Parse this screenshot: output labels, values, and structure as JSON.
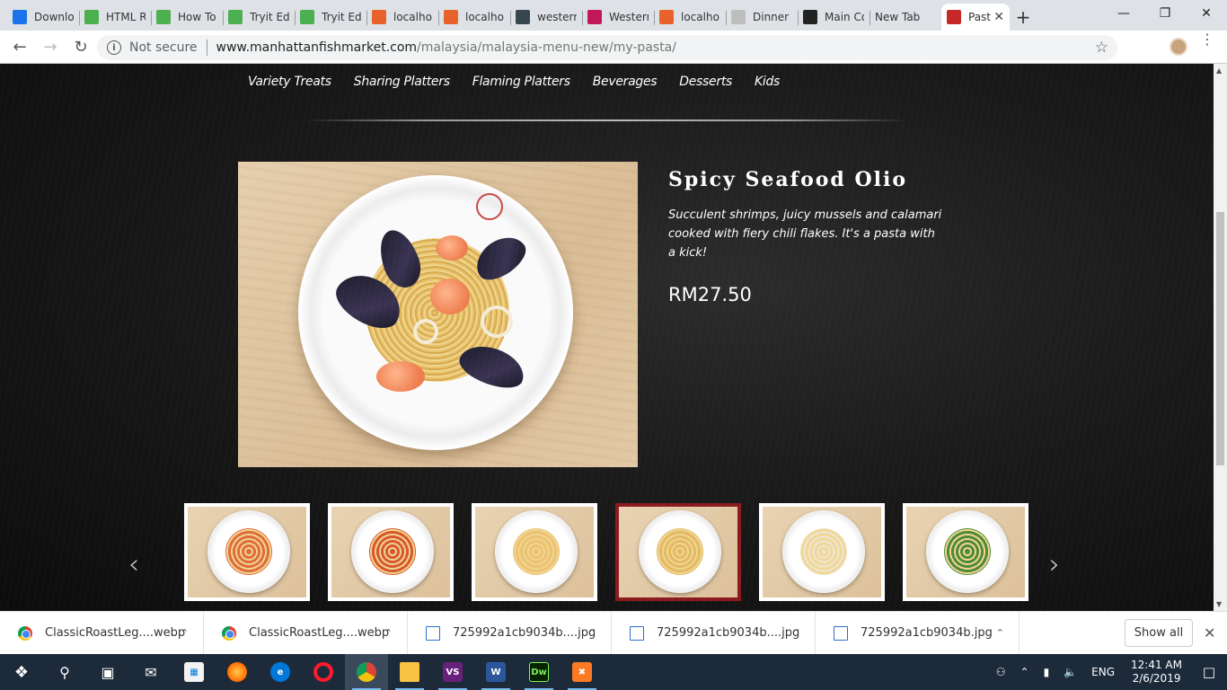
{
  "browser": {
    "tabs": [
      {
        "title": "Downlo",
        "icon": "download-icon",
        "color": "#1a73e8"
      },
      {
        "title": "HTML R",
        "icon": "w3-icon",
        "color": "#4caf50"
      },
      {
        "title": "How To",
        "icon": "w3-icon",
        "color": "#4caf50"
      },
      {
        "title": "Tryit Ed",
        "icon": "w3-icon",
        "color": "#4caf50"
      },
      {
        "title": "Tryit Ed",
        "icon": "w3-icon",
        "color": "#4caf50"
      },
      {
        "title": "localho",
        "icon": "xampp-icon",
        "color": "#e8632b"
      },
      {
        "title": "localho",
        "icon": "xampp-icon",
        "color": "#e8632b"
      },
      {
        "title": "western",
        "icon": "monitor-icon",
        "color": "#37474f"
      },
      {
        "title": "Westerr",
        "icon": "play-icon",
        "color": "#c2185b"
      },
      {
        "title": "localho",
        "icon": "xampp-icon",
        "color": "#e8632b"
      },
      {
        "title": "Dinner",
        "icon": "image-icon",
        "color": "#bdbdbd"
      },
      {
        "title": "Main Co",
        "icon": "s-icon",
        "color": "#222222"
      },
      {
        "title": "New Tab",
        "icon": "",
        "color": ""
      },
      {
        "title": "Past",
        "icon": "fish-market-icon",
        "color": "#c62828",
        "active": true
      }
    ],
    "address": {
      "security": "Not secure",
      "host": "www.manhattanfishmarket.com",
      "path": "/malaysia/malaysia-menu-new/my-pasta/"
    }
  },
  "page": {
    "categories": [
      "Variety Treats",
      "Sharing Platters",
      "Flaming Platters",
      "Beverages",
      "Desserts",
      "Kids"
    ],
    "dish": {
      "title": "Spicy Seafood Olio",
      "description": "Succulent shrimps, juicy mussels and calamari cooked with fiery chili flakes. It's a pasta with a kick!",
      "price": "RM27.50"
    },
    "thumbnails": [
      {
        "label": "pasta-thumb-1",
        "sauce": "#e06c3c"
      },
      {
        "label": "pasta-thumb-2",
        "sauce": "#d8572f"
      },
      {
        "label": "pasta-thumb-3",
        "sauce": "#ecc172"
      },
      {
        "label": "pasta-thumb-4",
        "sauce": "#e3b964",
        "selected": true
      },
      {
        "label": "pasta-thumb-5",
        "sauce": "#efe2c5"
      },
      {
        "label": "pasta-thumb-6",
        "sauce": "#4f8a3a"
      }
    ],
    "prev_label": "‹",
    "next_label": "›"
  },
  "downloads": {
    "items": [
      {
        "name": "ClassicRoastLeg....webp",
        "type": "chrome"
      },
      {
        "name": "ClassicRoastLeg....webp",
        "type": "chrome"
      },
      {
        "name": "725992a1cb9034b....jpg",
        "type": "file"
      },
      {
        "name": "725992a1cb9034b....jpg",
        "type": "file"
      },
      {
        "name": "725992a1cb9034b.jpg",
        "type": "file"
      }
    ],
    "show_all": "Show all"
  },
  "taskbar": {
    "language": "ENG",
    "time": "12:41 AM",
    "date": "2/6/2019"
  }
}
